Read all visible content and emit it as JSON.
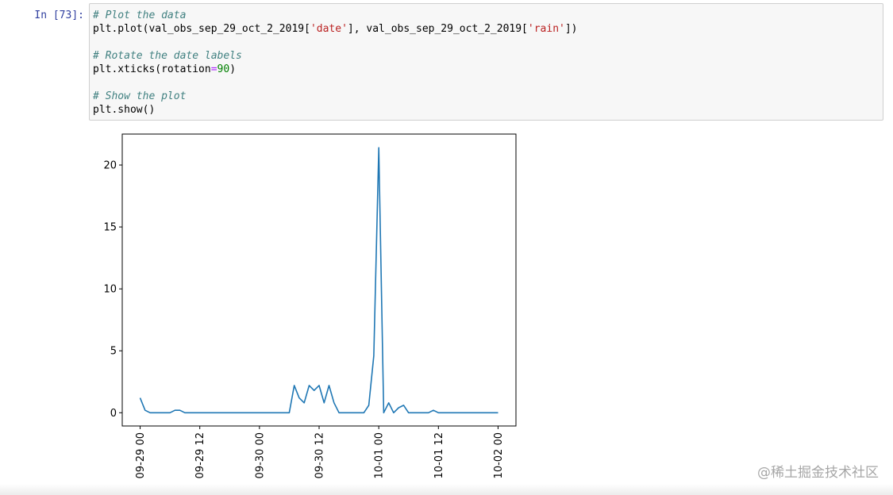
{
  "cell": {
    "prompt": "In [73]:",
    "lines": [
      [
        {
          "t": "# Plot the data",
          "c": "cm"
        }
      ],
      [
        {
          "t": "plt.plot(val_obs_sep_29_oct_2_2019[",
          "c": ""
        },
        {
          "t": "'date'",
          "c": "st"
        },
        {
          "t": "], val_obs_sep_29_oct_2_2019[",
          "c": ""
        },
        {
          "t": "'rain'",
          "c": "st"
        },
        {
          "t": "])",
          "c": ""
        }
      ],
      [
        {
          "t": "",
          "c": ""
        }
      ],
      [
        {
          "t": "# Rotate the date labels",
          "c": "cm"
        }
      ],
      [
        {
          "t": "plt.xticks(rotation",
          "c": ""
        },
        {
          "t": "=",
          "c": "op"
        },
        {
          "t": "90",
          "c": "nu"
        },
        {
          "t": ")",
          "c": ""
        }
      ],
      [
        {
          "t": "",
          "c": ""
        }
      ],
      [
        {
          "t": "# Show the plot",
          "c": "cm"
        }
      ],
      [
        {
          "t": "plt.show()",
          "c": ""
        }
      ]
    ]
  },
  "chart_data": {
    "type": "line",
    "line_color": "#1f77b4",
    "x_tick_labels": [
      "09-29 00",
      "09-29 12",
      "09-30 00",
      "09-30 12",
      "10-01 00",
      "10-01 12",
      "10-02 00"
    ],
    "x_tick_hours": [
      0,
      12,
      24,
      36,
      48,
      60,
      72
    ],
    "y_ticks": [
      0,
      5,
      10,
      15,
      20
    ],
    "xlim": [
      -3.6,
      75.6
    ],
    "ylim": [
      -1.07,
      22.5
    ],
    "series": [
      {
        "x_hours": [
          0,
          1,
          2,
          3,
          4,
          5,
          6,
          7,
          8,
          9,
          10,
          11,
          12,
          13,
          14,
          15,
          16,
          17,
          18,
          19,
          20,
          21,
          22,
          23,
          24,
          25,
          26,
          27,
          28,
          29,
          30,
          31,
          32,
          33,
          34,
          35,
          36,
          37,
          38,
          39,
          40,
          41,
          42,
          43,
          44,
          45,
          46,
          47,
          48,
          49,
          50,
          51,
          52,
          53,
          54,
          55,
          56,
          57,
          58,
          59,
          60,
          61,
          62,
          63,
          64,
          65,
          66,
          67,
          68,
          69,
          70,
          71,
          72
        ],
        "values": [
          1.2,
          0.2,
          0,
          0,
          0,
          0,
          0,
          0.2,
          0.2,
          0,
          0,
          0,
          0,
          0,
          0,
          0,
          0,
          0,
          0,
          0,
          0,
          0,
          0,
          0,
          0,
          0,
          0,
          0,
          0,
          0,
          0,
          2.2,
          1.2,
          0.8,
          2.2,
          1.8,
          2.2,
          0.8,
          2.2,
          0.8,
          0,
          0,
          0,
          0,
          0,
          0,
          0.6,
          4.6,
          21.4,
          0,
          0.8,
          0,
          0.4,
          0.6,
          0,
          0,
          0,
          0,
          0,
          0.2,
          0,
          0,
          0,
          0,
          0,
          0,
          0,
          0,
          0,
          0,
          0,
          0,
          0
        ]
      }
    ]
  },
  "watermark": "@稀土掘金技术社区"
}
